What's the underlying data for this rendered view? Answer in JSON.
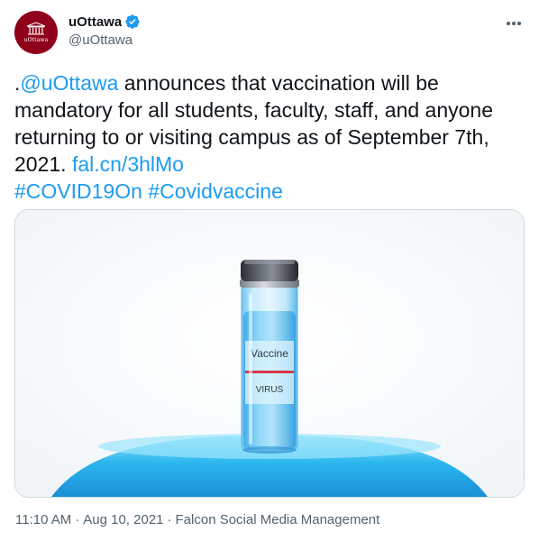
{
  "account": {
    "display_name": "uOttawa",
    "handle": "@uOttawa",
    "avatar_text": "uOttawa",
    "verified": true
  },
  "tweet": {
    "segments": [
      {
        "text": ".",
        "link": false
      },
      {
        "text": "@uOttawa",
        "link": true
      },
      {
        "text": " announces that vaccination will be mandatory for all students, faculty, staff, and anyone returning to or visiting campus as of September 7th, 2021. ",
        "link": false
      },
      {
        "text": "fal.cn/3hlMo",
        "link": true
      },
      {
        "text": "\n",
        "link": false
      },
      {
        "text": "#COVID19On",
        "link": true
      },
      {
        "text": " ",
        "link": false
      },
      {
        "text": "#Covidvaccine",
        "link": true
      }
    ]
  },
  "media": {
    "vial_label_top": "Vaccine",
    "vial_label_bottom": "VIRUS"
  },
  "meta": {
    "time": "11:10 AM",
    "separator": "·",
    "date": "Aug 10, 2021",
    "source": "Falcon Social Media Management"
  },
  "colors": {
    "link": "#1d9bf0",
    "text": "#0f1419",
    "muted": "#536471",
    "avatar_bg": "#8f001a",
    "verified": "#1d9bf0"
  },
  "icons": [
    "verified-badge-icon",
    "more-options-icon",
    "university-crest-icon"
  ]
}
